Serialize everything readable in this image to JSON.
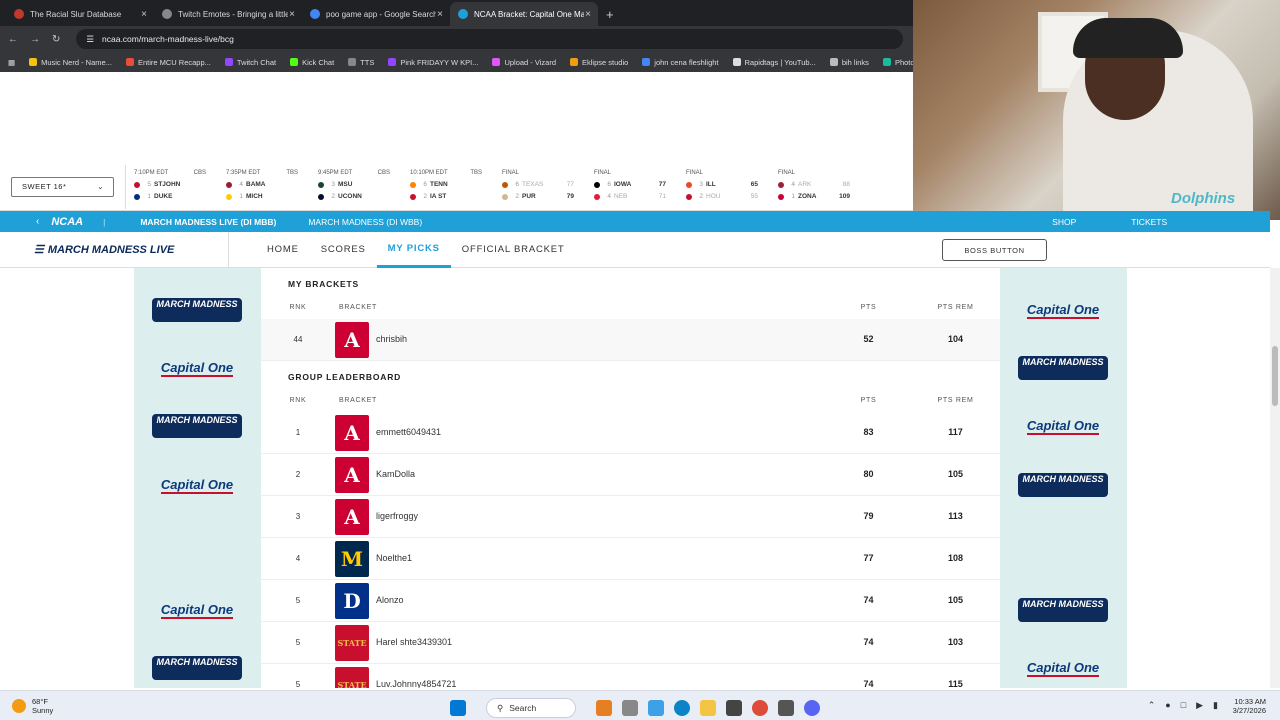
{
  "browser": {
    "tabs": [
      {
        "title": "The Racial Slur Database",
        "color": "#c0392b"
      },
      {
        "title": "Twitch Emotes - Bringing a little...",
        "color": "#888888"
      },
      {
        "title": "poo game app - Google Search",
        "color": "#4285f4"
      },
      {
        "title": "NCAA Bracket: Capital One Ma...",
        "color": "#1fa0d7"
      }
    ],
    "url": "ncaa.com/march-madness-live/bcg",
    "bookmarks": [
      {
        "label": "Music Nerd - Name...",
        "color": "#f1c40f"
      },
      {
        "label": "Entire MCU Recapp...",
        "color": "#e74c3c"
      },
      {
        "label": "Twitch Chat",
        "color": "#9146ff"
      },
      {
        "label": "Kick Chat",
        "color": "#53fc18"
      },
      {
        "label": "TTS",
        "color": "#888888"
      },
      {
        "label": "Pink FRIDAYY W KPI...",
        "color": "#9146ff"
      },
      {
        "label": "Upload - Vizard",
        "color": "#e056fd"
      },
      {
        "label": "Eklipse studio",
        "color": "#f39c12"
      },
      {
        "label": "john cena fleshlight",
        "color": "#4285f4"
      },
      {
        "label": "Rapidtags | YouTub...",
        "color": "#dddddd"
      },
      {
        "label": "bih links",
        "color": "#bbbbbb"
      },
      {
        "label": "Photopea",
        "color": "#1abc9c"
      }
    ]
  },
  "webcam": {
    "shirt_text": "Dolphins"
  },
  "scoreboard": {
    "round_selector": "SWEET 16*",
    "games": [
      {
        "time": "7:10PM EDT",
        "net": "CBS",
        "t1": {
          "seed": "5",
          "name": "STJOHN",
          "score": "",
          "color": "#c8102e"
        },
        "t2": {
          "seed": "1",
          "name": "DUKE",
          "score": "",
          "color": "#003087"
        }
      },
      {
        "time": "7:35PM EDT",
        "net": "TBS",
        "t1": {
          "seed": "4",
          "name": "BAMA",
          "score": "",
          "color": "#9e1b32"
        },
        "t2": {
          "seed": "1",
          "name": "MICH",
          "score": "",
          "color": "#ffcb05"
        }
      },
      {
        "time": "9:45PM EDT",
        "net": "CBS",
        "t1": {
          "seed": "3",
          "name": "MSU",
          "score": "",
          "color": "#18453b"
        },
        "t2": {
          "seed": "2",
          "name": "UCONN",
          "score": "",
          "color": "#000e2f"
        }
      },
      {
        "time": "10:10PM EDT",
        "net": "TBS",
        "t1": {
          "seed": "6",
          "name": "TENN",
          "score": "",
          "color": "#ff8200"
        },
        "t2": {
          "seed": "2",
          "name": "IA ST",
          "score": "",
          "color": "#c8102e"
        }
      },
      {
        "time": "FINAL",
        "net": "",
        "t1": {
          "seed": "6",
          "name": "TEXAS",
          "score": "77",
          "color": "#bf5700",
          "dim": true
        },
        "t2": {
          "seed": "2",
          "name": "PUR",
          "score": "79",
          "color": "#cfb991"
        }
      },
      {
        "time": "FINAL",
        "net": "",
        "t1": {
          "seed": "6",
          "name": "IOWA",
          "score": "77",
          "color": "#000000"
        },
        "t2": {
          "seed": "4",
          "name": "NEB",
          "score": "71",
          "color": "#e41c38",
          "dim": true
        }
      },
      {
        "time": "FINAL",
        "net": "",
        "t1": {
          "seed": "3",
          "name": "ILL",
          "score": "65",
          "color": "#e84a27"
        },
        "t2": {
          "seed": "2",
          "name": "HOU",
          "score": "55",
          "color": "#c8102e",
          "dim": true
        }
      },
      {
        "time": "FINAL",
        "net": "",
        "t1": {
          "seed": "4",
          "name": "ARK",
          "score": "88",
          "color": "#9d2235",
          "dim": true
        },
        "t2": {
          "seed": "1",
          "name": "ZONA",
          "score": "109",
          "color": "#cc0033"
        }
      }
    ]
  },
  "bluebar": {
    "ncaa": "NCAA",
    "item1": "MARCH MADNESS LIVE (DI MBB)",
    "item2": "MARCH MADNESS (DI WBB)",
    "shop": "SHOP",
    "tickets": "TICKETS"
  },
  "nav": {
    "logo": "MARCH MADNESS LIVE",
    "items": [
      "HOME",
      "SCORES",
      "MY PICKS",
      "OFFICIAL BRACKET"
    ],
    "active": "MY PICKS",
    "boss_button": "BOSS BUTTON"
  },
  "ads": {
    "march_madness": "MARCH MADNESS",
    "capital_one": "Capital One"
  },
  "my_brackets": {
    "title": "MY BRACKETS",
    "headers": {
      "rank": "RNK",
      "bracket": "BRACKET",
      "pts": "PTS",
      "rem": "PTS REM"
    },
    "rows": [
      {
        "rank": "44",
        "name": "chrisbih",
        "pts": "52",
        "rem": "104",
        "logo": "A",
        "color": "#cc0033"
      }
    ]
  },
  "leaderboard": {
    "title": "GROUP LEADERBOARD",
    "headers": {
      "rank": "RNK",
      "bracket": "BRACKET",
      "pts": "PTS",
      "rem": "PTS REM"
    },
    "rows": [
      {
        "rank": "1",
        "name": "emmett6049431",
        "pts": "83",
        "rem": "117",
        "logo": "A",
        "color": "#cc0033"
      },
      {
        "rank": "2",
        "name": "KamDolla",
        "pts": "80",
        "rem": "105",
        "logo": "A",
        "color": "#cc0033"
      },
      {
        "rank": "3",
        "name": "ligerfroggy",
        "pts": "79",
        "rem": "113",
        "logo": "A",
        "color": "#cc0033"
      },
      {
        "rank": "4",
        "name": "Noelthe1",
        "pts": "77",
        "rem": "108",
        "logo": "M",
        "color": "#00274c"
      },
      {
        "rank": "5",
        "name": "Alonzo",
        "pts": "74",
        "rem": "105",
        "logo": "D",
        "color": "#003087"
      },
      {
        "rank": "5",
        "name": "Harel shte3439301",
        "pts": "74",
        "rem": "103",
        "logo": "STATE",
        "color": "#c8102e"
      },
      {
        "rank": "5",
        "name": "Luv.Johnny4854721",
        "pts": "74",
        "rem": "115",
        "logo": "STATE",
        "color": "#c8102e"
      }
    ]
  },
  "taskbar": {
    "temp": "68°F",
    "condition": "Sunny",
    "search": "Search",
    "time": "10:33 AM",
    "date": "3/27/2026"
  }
}
